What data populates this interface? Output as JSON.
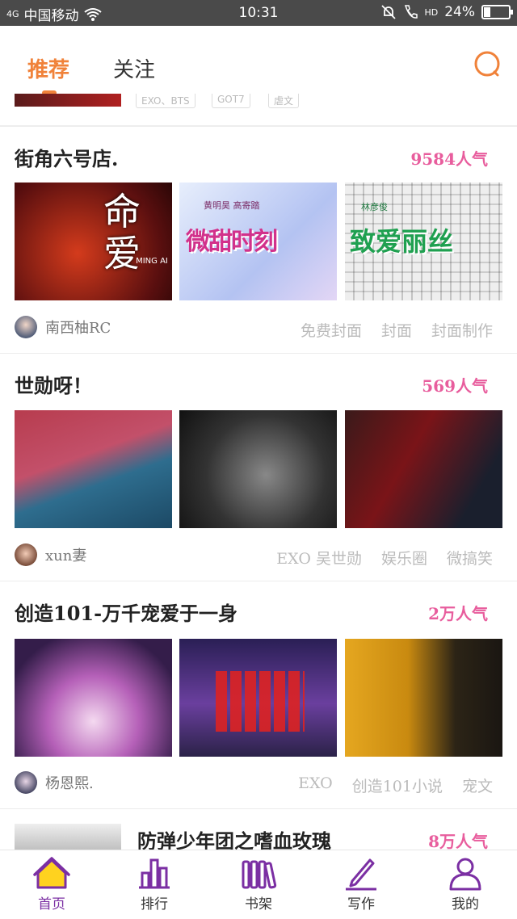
{
  "status": {
    "signal": "4G",
    "carrier": "中国移动",
    "time": "10:31",
    "hd": "HD",
    "battery": "24%"
  },
  "tabs": [
    {
      "label": "推荐",
      "active": true
    },
    {
      "label": "关注",
      "active": false
    }
  ],
  "partial": {
    "tags": [
      "EXO、BTS",
      "GOT7",
      "虐文"
    ]
  },
  "sections": [
    {
      "title": "街角六号店.",
      "popularity": "9584人气",
      "author": "南西柚RC",
      "tags": [
        "免费封面",
        "封面",
        "封面制作"
      ],
      "thumb_texts": [
        {
          "big": "命爱",
          "small": "MING AI"
        },
        {
          "big": "微甜时刻",
          "small": "黄明昊 高寄踏"
        },
        {
          "big": "致爱丽丝",
          "small": "林彦俊"
        }
      ]
    },
    {
      "title": "世勋呀！",
      "popularity": "569人气",
      "author": "xun妻",
      "tags": [
        "EXO 吴世勋",
        "娱乐圈",
        "微搞笑"
      ]
    },
    {
      "title": "创造101-万千宠爱于一身",
      "popularity": "2万人气",
      "author": "杨恩熙.",
      "tags": [
        "EXO",
        "创造101小说",
        "宠文"
      ]
    },
    {
      "title": "防弹少年团之嗜血玫瑰",
      "popularity": "8万人气"
    }
  ],
  "bottom_nav": [
    {
      "label": "首页",
      "icon": "home-icon",
      "active": true
    },
    {
      "label": "排行",
      "icon": "ranking-icon",
      "active": false
    },
    {
      "label": "书架",
      "icon": "bookshelf-icon",
      "active": false
    },
    {
      "label": "写作",
      "icon": "pen-icon",
      "active": false
    },
    {
      "label": "我的",
      "icon": "profile-icon",
      "active": false
    }
  ],
  "colors": {
    "accent": "#f0823a",
    "popularity": "#e85d9d",
    "nav_active": "#7b2fa3",
    "status_bar": "#4a4a4a"
  }
}
